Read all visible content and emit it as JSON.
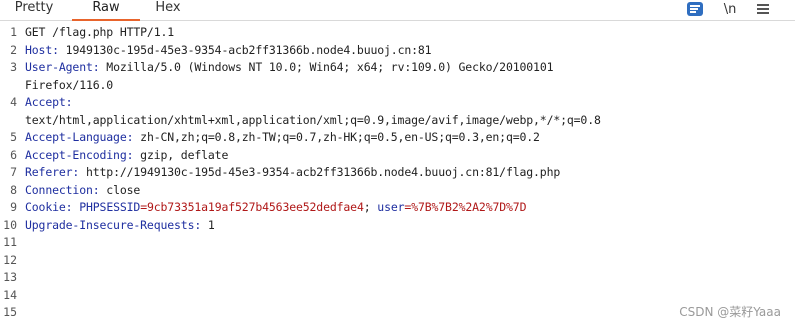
{
  "tabs": {
    "pretty": "Pretty",
    "raw": "Raw",
    "hex": "Hex"
  },
  "toolbar": {
    "newline_label": "\\n"
  },
  "icons": {
    "toggle": "list-view-icon",
    "newline": "newline-icon",
    "menu": "hamburger-menu-icon"
  },
  "colors": {
    "header_name": "#1f2fa0",
    "cookie_value": "#b01818",
    "tab_underline": "#e8642c",
    "toggle_bg": "#2f6ec0"
  },
  "line_numbers": [
    "1",
    "2",
    "3",
    "4",
    "5",
    "6",
    "7",
    "8",
    "9",
    "10",
    "11",
    "12",
    "13",
    "14",
    "15"
  ],
  "request": {
    "l1": "GET /flag.php HTTP/1.1",
    "host": {
      "name": "Host",
      "value": " 1949130c-195d-45e3-9354-acb2ff31366b.node4.buuoj.cn:81"
    },
    "ua": {
      "name": "User-Agent",
      "value": " Mozilla/5.0 (Windows NT 10.0; Win64; x64; rv:109.0) Gecko/20100101",
      "cont": "Firefox/116.0"
    },
    "accept": {
      "name": "Accept",
      "cont": "text/html,application/xhtml+xml,application/xml;q=0.9,image/avif,image/webp,*/*;q=0.8"
    },
    "lang": {
      "name": "Accept-Language",
      "value": " zh-CN,zh;q=0.8,zh-TW;q=0.7,zh-HK;q=0.5,en-US;q=0.3,en;q=0.2"
    },
    "enc": {
      "name": "Accept-Encoding",
      "value": " gzip, deflate"
    },
    "ref": {
      "name": "Referer",
      "value": " http://1949130c-195d-45e3-9354-acb2ff31366b.node4.buuoj.cn:81/flag.php"
    },
    "conn": {
      "name": "Connection",
      "value": " close"
    },
    "cookie": {
      "name": "Cookie",
      "k1": "PHPSESSID",
      "eq1": "=",
      "v1": "9cb73351a19af527b4563ee52dedfae4",
      "sep": "; ",
      "k2": "user",
      "eq2": "=",
      "v2": "%7B%7B2%2A2%7D%7D"
    },
    "upg": {
      "name": "Upgrade-Insecure-Requests",
      "value": " 1"
    },
    "colon": ":"
  },
  "watermark": "CSDN @菜籽Yaaa"
}
